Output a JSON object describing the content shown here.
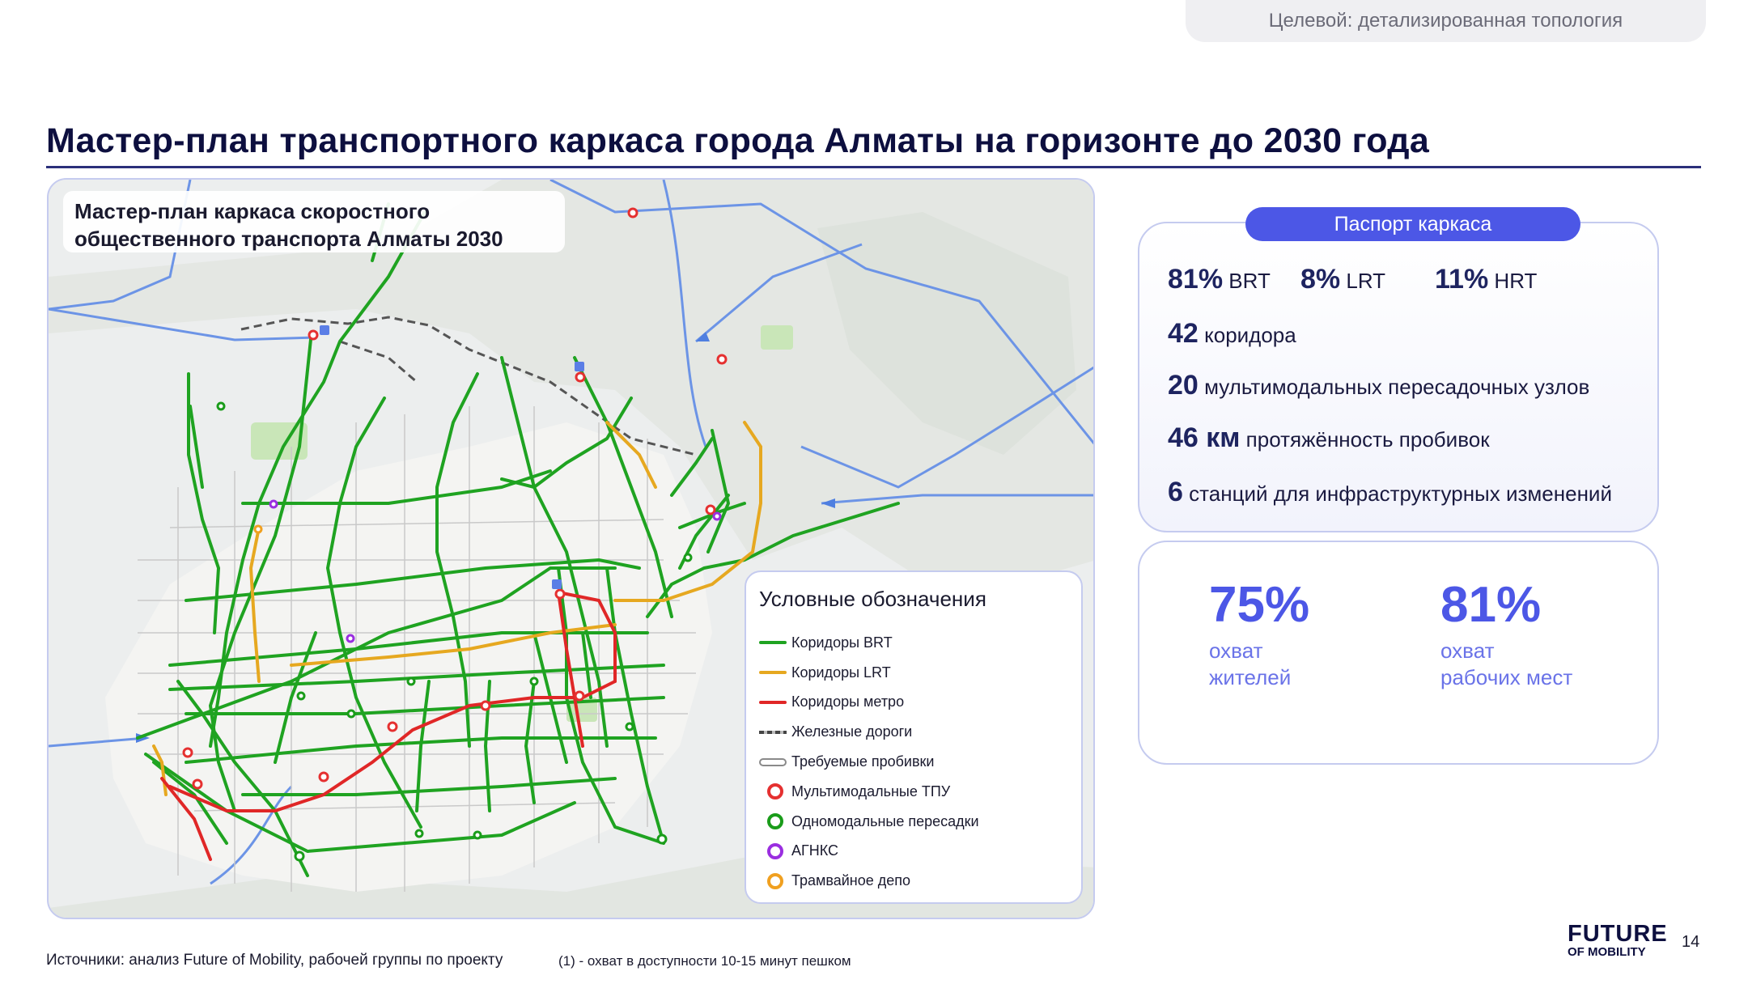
{
  "header": {
    "tag": "Целевой: детализированная топология",
    "title": "Мастер-план транспортного каркаса города Алматы на горизонте до 2030 года"
  },
  "map": {
    "caption_line1": "Мастер-план каркаса скоростного",
    "caption_line2": "общественного транспорта Алматы 2030",
    "legend": {
      "title": "Условные обозначения",
      "items": [
        {
          "label": "Коридоры BRT",
          "kind": "line",
          "color": "#1fa321"
        },
        {
          "label": "Коридоры LRT",
          "kind": "line",
          "color": "#e6a820"
        },
        {
          "label": "Коридоры метро",
          "kind": "line",
          "color": "#e02727"
        },
        {
          "label": "Железные дороги",
          "kind": "rail",
          "color": "#444444"
        },
        {
          "label": "Требуемые пробивки",
          "kind": "break",
          "color": "#8a8a8a"
        },
        {
          "label": "Мультимодальные ТПУ",
          "kind": "ring",
          "color": "#e53030"
        },
        {
          "label": "Одномодальные пересадки",
          "kind": "ring",
          "color": "#1a9c1a"
        },
        {
          "label": "АГНКС",
          "kind": "ring",
          "color": "#9a2ee0"
        },
        {
          "label": "Трамвайное депо",
          "kind": "ring",
          "color": "#f0a020"
        }
      ]
    }
  },
  "passport": {
    "title": "Паспорт каркаса",
    "shares": [
      {
        "value": "81%",
        "label": "BRT"
      },
      {
        "value": "8%",
        "label": "LRT"
      },
      {
        "value": "11%",
        "label": "HRT"
      }
    ],
    "stats": [
      {
        "value": "42",
        "label": "коридора"
      },
      {
        "value": "20",
        "label": "мультимодальных пересадочных узлов"
      },
      {
        "value": "46 км",
        "label": "протяжённость пробивок"
      },
      {
        "value": "6",
        "label": "станций для инфраструктурных изменений"
      }
    ]
  },
  "coverage": [
    {
      "value": "75%",
      "line1": "охват",
      "line2": "жителей"
    },
    {
      "value": "81%",
      "line1": "охват",
      "line2": "рабочих мест"
    }
  ],
  "footer": {
    "sources": "Источники: анализ Future of Mobility, рабочей группы по проекту",
    "note": "(1) - охват в доступности 10-15 минут пешком",
    "brand_line1": "FUTURE",
    "brand_line2": "OF MOBILITY",
    "page_number": "14"
  }
}
